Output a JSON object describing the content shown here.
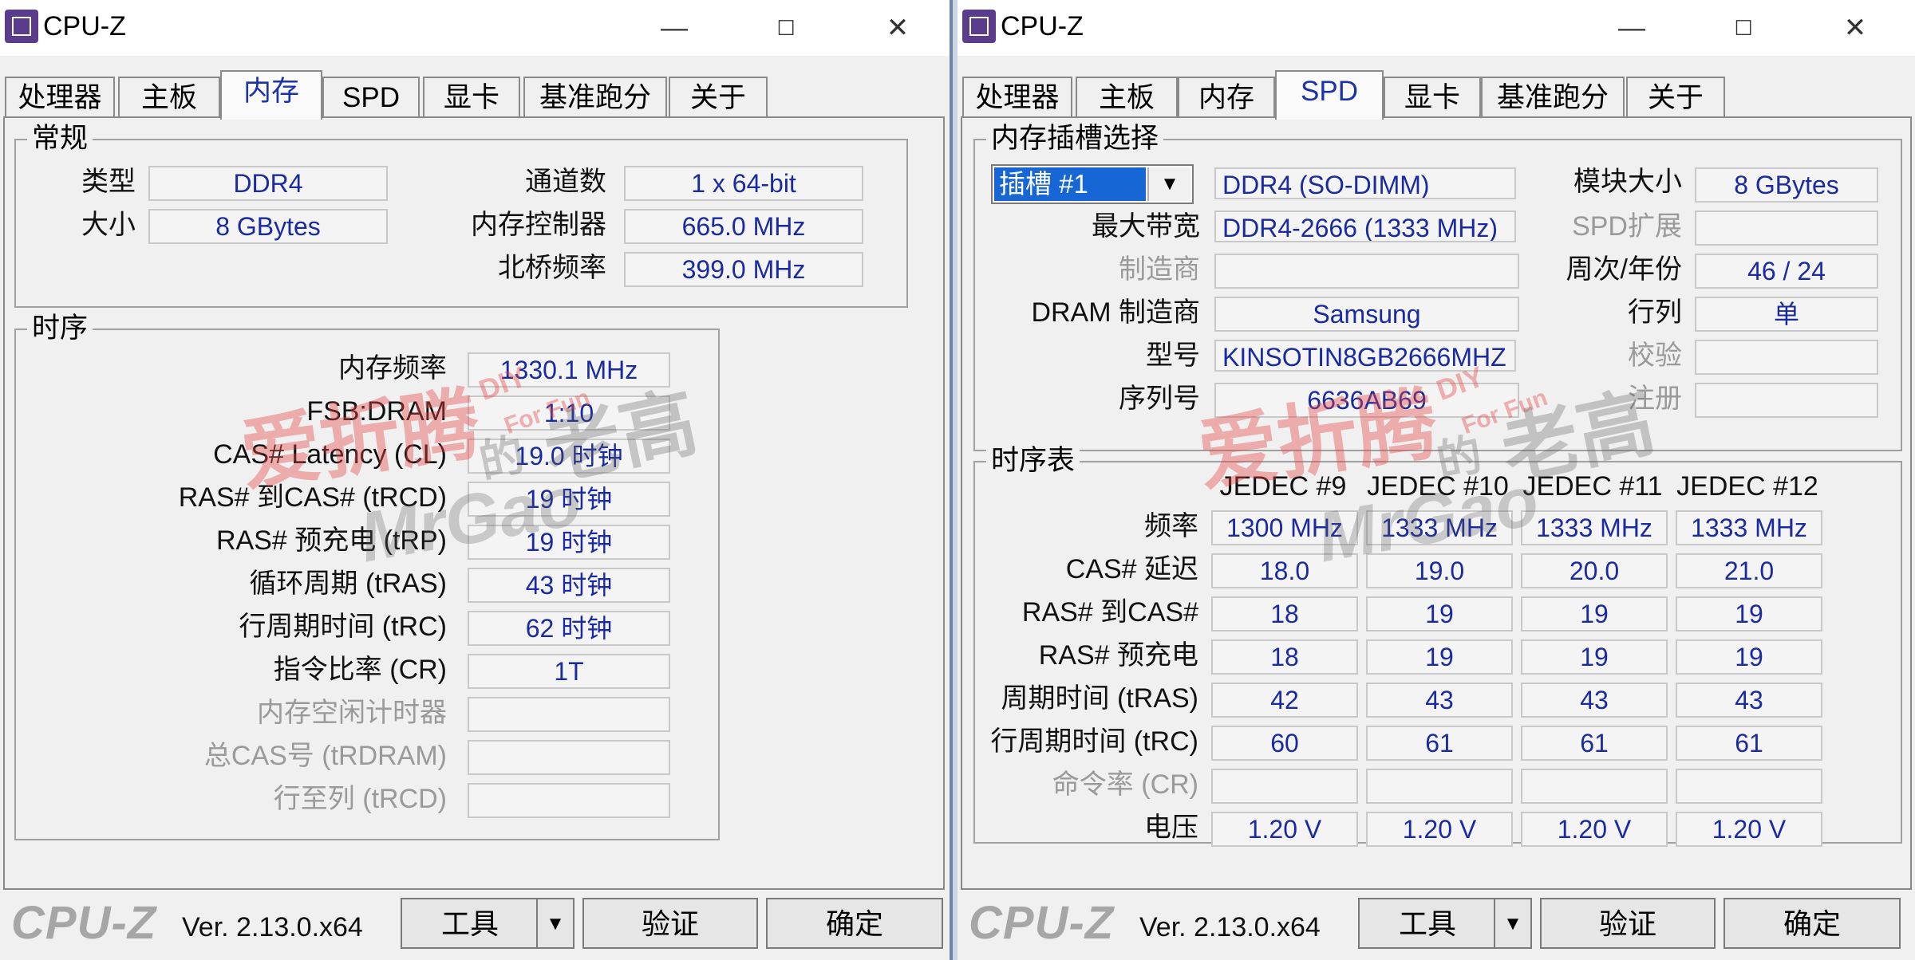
{
  "app_title": "CPU-Z",
  "window_controls": {
    "minimize": "—",
    "maximize": "☐",
    "close": "✕"
  },
  "tabs": [
    "处理器",
    "主板",
    "内存",
    "SPD",
    "显卡",
    "基准跑分",
    "关于"
  ],
  "footer": {
    "logo": "CPU-Z",
    "version": "Ver. 2.13.0.x64",
    "tools": "工具",
    "validate": "验证",
    "ok": "确定"
  },
  "watermark": {
    "brand": "爱折腾",
    "diy": "DIY",
    "forfun": "For Fun",
    "de": "的",
    "laogao": "老高",
    "mrgao": "MrGao"
  },
  "memory": {
    "general_title": "常规",
    "type_label": "类型",
    "type": "DDR4",
    "size_label": "大小",
    "size": "8 GBytes",
    "channels_label": "通道数",
    "channels": "1 x 64-bit",
    "mc_label": "内存控制器",
    "mc": "665.0 MHz",
    "nb_label": "北桥频率",
    "nb": "399.0 MHz",
    "timings_title": "时序",
    "timings": [
      {
        "label": "内存频率",
        "value": "1330.1 MHz",
        "dim": false
      },
      {
        "label": "FSB:DRAM",
        "value": "1:10",
        "dim": false
      },
      {
        "label": "CAS# Latency (CL)",
        "value": "19.0 时钟",
        "dim": false
      },
      {
        "label": "RAS# 到CAS# (tRCD)",
        "value": "19 时钟",
        "dim": false
      },
      {
        "label": "RAS# 预充电 (tRP)",
        "value": "19 时钟",
        "dim": false
      },
      {
        "label": "循环周期 (tRAS)",
        "value": "43 时钟",
        "dim": false
      },
      {
        "label": "行周期时间 (tRC)",
        "value": "62 时钟",
        "dim": false
      },
      {
        "label": "指令比率 (CR)",
        "value": "1T",
        "dim": false
      },
      {
        "label": "内存空闲计时器",
        "value": "",
        "dim": true
      },
      {
        "label": "总CAS号 (tRDRAM)",
        "value": "",
        "dim": true
      },
      {
        "label": "行至列 (tRCD)",
        "value": "",
        "dim": true
      }
    ]
  },
  "spd": {
    "slot_title": "内存插槽选择",
    "slot": "插槽 #1",
    "module_type": "DDR4 (SO-DIMM)",
    "module_size_label": "模块大小",
    "module_size": "8 GBytes",
    "max_bw_label": "最大带宽",
    "max_bw": "DDR4-2666 (1333 MHz)",
    "spd_ext_label": "SPD扩展",
    "spd_ext": "",
    "mfr_label": "制造商",
    "mfr": "",
    "week_year_label": "周次/年份",
    "week_year": "46 / 24",
    "dram_mfr_label": "DRAM 制造商",
    "dram_mfr": "Samsung",
    "ranks_label": "行列",
    "ranks": "单",
    "part_label": "型号",
    "part": "KINSOTIN8GB2666MHZ",
    "correction_label": "校验",
    "correction": "",
    "serial_label": "序列号",
    "serial": "6636AB69",
    "registered_label": "注册",
    "registered": "",
    "timing_table_title": "时序表",
    "columns": [
      "JEDEC #9",
      "JEDEC #10",
      "JEDEC #11",
      "JEDEC #12"
    ],
    "rows": [
      {
        "label": "频率",
        "dim": false,
        "values": [
          "1300 MHz",
          "1333 MHz",
          "1333 MHz",
          "1333 MHz"
        ]
      },
      {
        "label": "CAS# 延迟",
        "dim": false,
        "values": [
          "18.0",
          "19.0",
          "20.0",
          "21.0"
        ]
      },
      {
        "label": "RAS# 到CAS#",
        "dim": false,
        "values": [
          "18",
          "19",
          "19",
          "19"
        ]
      },
      {
        "label": "RAS# 预充电",
        "dim": false,
        "values": [
          "18",
          "19",
          "19",
          "19"
        ]
      },
      {
        "label": "周期时间 (tRAS)",
        "dim": false,
        "values": [
          "42",
          "43",
          "43",
          "43"
        ]
      },
      {
        "label": "行周期时间 (tRC)",
        "dim": false,
        "values": [
          "60",
          "61",
          "61",
          "61"
        ]
      },
      {
        "label": "命令率 (CR)",
        "dim": true,
        "values": [
          "",
          "",
          "",
          ""
        ]
      },
      {
        "label": "电压",
        "dim": false,
        "values": [
          "1.20 V",
          "1.20 V",
          "1.20 V",
          "1.20 V"
        ]
      }
    ]
  }
}
